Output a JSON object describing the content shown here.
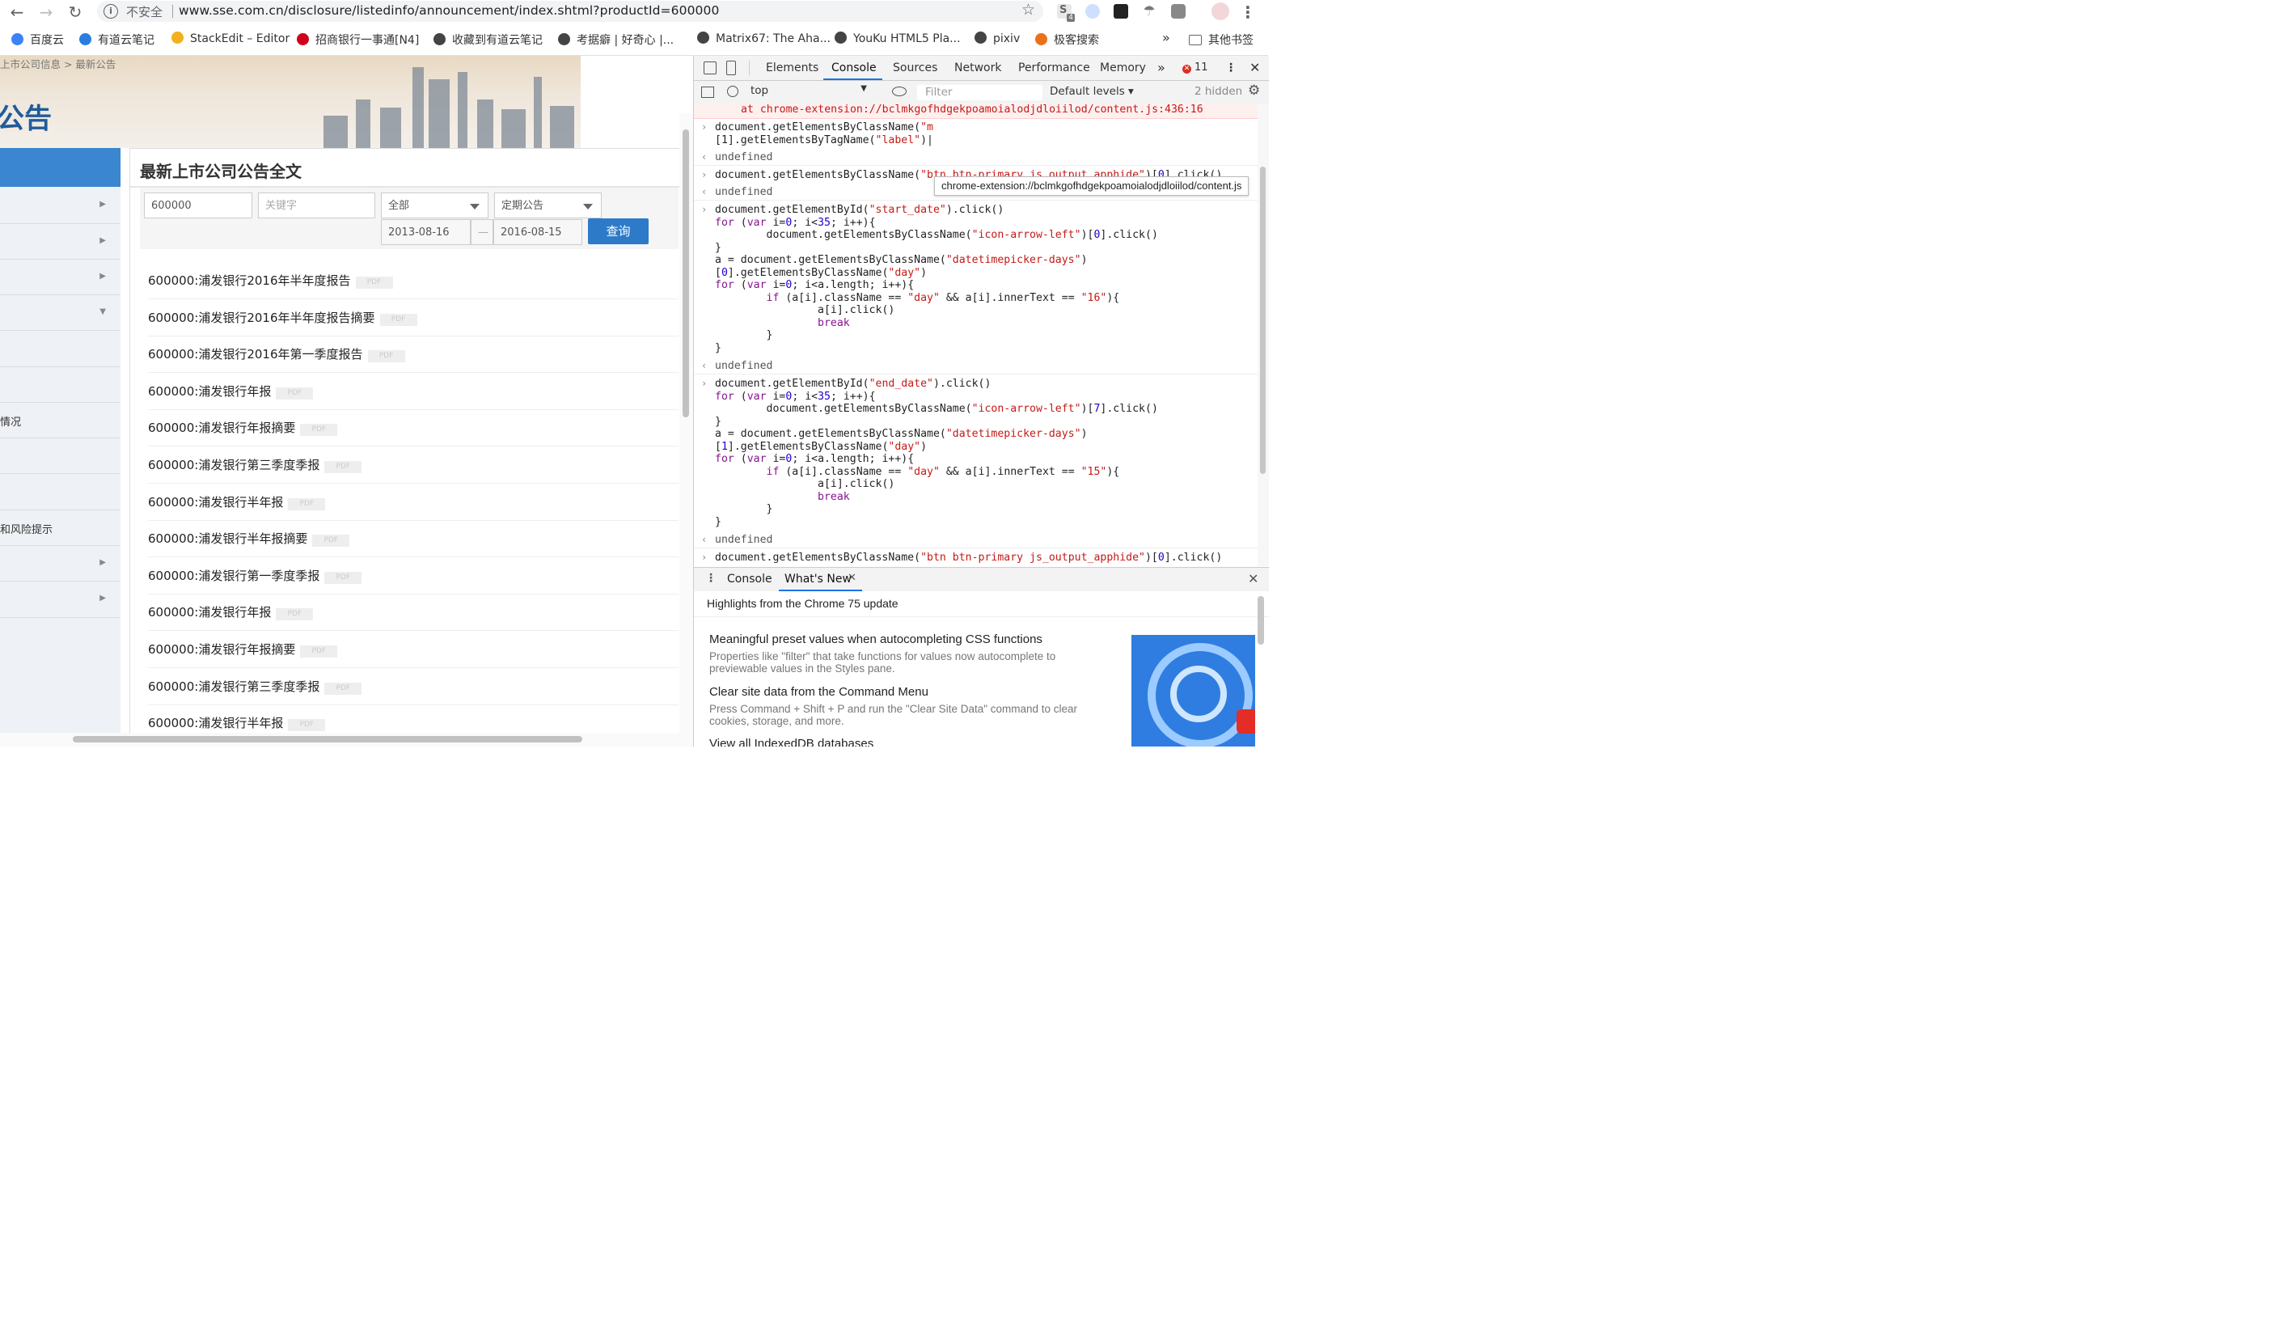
{
  "browser": {
    "security_label": "不安全",
    "url": "www.sse.com.cn/disclosure/listedinfo/announcement/index.shtml?productId=600000",
    "extension_badge": "4"
  },
  "bookmarks": [
    {
      "label": "百度云",
      "color": "#3b82f6"
    },
    {
      "label": "有道云笔记",
      "color": "#2a7de1"
    },
    {
      "label": "StackEdit – Editor",
      "color": "#f2b01e"
    },
    {
      "label": "招商银行一事通[N4]",
      "color": "#d0021b"
    },
    {
      "label": "收藏到有道云笔记",
      "color": "#444444"
    },
    {
      "label": "考据癖 | 好奇心 |...",
      "color": "#444444"
    },
    {
      "label": "Matrix67: The Aha...",
      "color": "#444444"
    },
    {
      "label": "YouKu HTML5 Pla...",
      "color": "#444444"
    },
    {
      "label": "pixiv",
      "color": "#444444"
    },
    {
      "label": "极客搜索",
      "color": "#e8711a"
    }
  ],
  "bookmarks_more": "»",
  "bookmarks_other": "其他书签",
  "page": {
    "breadcrumb": "上市公司信息 > 最新公告",
    "big_title": "公告",
    "sidenav": [
      {
        "label": "",
        "arrow": ""
      },
      {
        "label": "",
        "arrow": "▶"
      },
      {
        "label": "",
        "arrow": "▶"
      },
      {
        "label": "",
        "arrow": "▶"
      },
      {
        "label": "",
        "arrow": "▼"
      },
      {
        "label": "",
        "arrow": ""
      },
      {
        "label": "",
        "arrow": ""
      },
      {
        "label": "情况",
        "arrow": ""
      },
      {
        "label": "",
        "arrow": ""
      },
      {
        "label": "",
        "arrow": ""
      },
      {
        "label": "和风险提示",
        "arrow": ""
      },
      {
        "label": "",
        "arrow": "▶"
      },
      {
        "label": "",
        "arrow": "▶"
      }
    ],
    "section_title": "最新上市公司公告全文",
    "search": {
      "code_value": "600000",
      "keyword_placeholder": "关键字",
      "type_select": "全部",
      "category_select": "定期公告",
      "start_date": "2013-08-16",
      "date_sep": "—",
      "end_date": "2016-08-15",
      "query_label": "查询"
    },
    "pdf_label": "PDF",
    "announcements": [
      "600000:浦发银行2016年半年度报告",
      "600000:浦发银行2016年半年度报告摘要",
      "600000:浦发银行2016年第一季度报告",
      "600000:浦发银行年报",
      "600000:浦发银行年报摘要",
      "600000:浦发银行第三季度季报",
      "600000:浦发银行半年报",
      "600000:浦发银行半年报摘要",
      "600000:浦发银行第一季度季报",
      "600000:浦发银行年报",
      "600000:浦发银行年报摘要",
      "600000:浦发银行第三季度季报",
      "600000:浦发银行半年报"
    ]
  },
  "devtools": {
    "tabs": [
      "Elements",
      "Console",
      "Sources",
      "Network",
      "Performance",
      "Memory"
    ],
    "more_tabs": "»",
    "error_count": "11",
    "context": "top",
    "filter_placeholder": "Filter",
    "levels": "Default levels ▾",
    "hidden": "2 hidden",
    "tooltip": "chrome-extension://bclmkgofhdgekpoamoialodjdloiilod/content.js",
    "error_line": "at chrome-extension://bclmkgofhdgekpoamoialodjdloiilod/content.js:436:16",
    "undefined_label": "undefined",
    "drawer_tabs": [
      "Console",
      "What's New"
    ],
    "drawer_highlight": "Highlights from the Chrome 75 update",
    "whats_new": [
      {
        "title": "Meaningful preset values when autocompleting CSS functions",
        "body": "Properties like \"filter\" that take functions for values now autocomplete to previewable values in the Styles pane."
      },
      {
        "title": "Clear site data from the Command Menu",
        "body": "Press Command + Shift + P and run the \"Clear Site Data\" command to clear cookies, storage, and more."
      },
      {
        "title": "View all IndexedDB databases",
        "body": ""
      }
    ]
  }
}
